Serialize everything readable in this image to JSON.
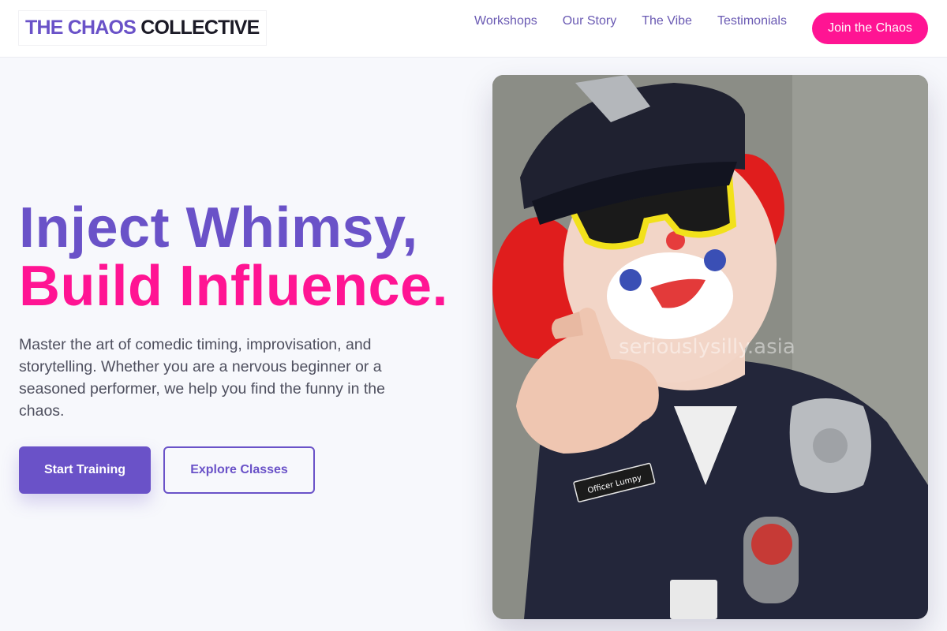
{
  "brand": {
    "name_part1": "THE CHAOS",
    "name_part2": "COLLECTIVE"
  },
  "nav": {
    "items": [
      "Workshops",
      "Our Story",
      "The Vibe",
      "Testimonials"
    ],
    "cta_label": "Join the Chaos"
  },
  "hero": {
    "headline_line1": "Inject Whimsy,",
    "headline_line2": "Build Influence.",
    "description": "Master the art of comedic timing, improvisation, and storytelling. Whether you are a nervous beginner or a seasoned performer, we help you find the funny in the chaos.",
    "primary_button": "Start Training",
    "secondary_button": "Explore Classes",
    "image": {
      "watermark": "seriouslysilly.asia",
      "name_tag": "Officer Lumpy"
    }
  },
  "colors": {
    "brand_purple": "#6a52c8",
    "accent_pink": "#ff1493",
    "text_dark": "#1b1a26",
    "body_text": "#4e4f5e",
    "page_bg": "#f7f8fc"
  }
}
